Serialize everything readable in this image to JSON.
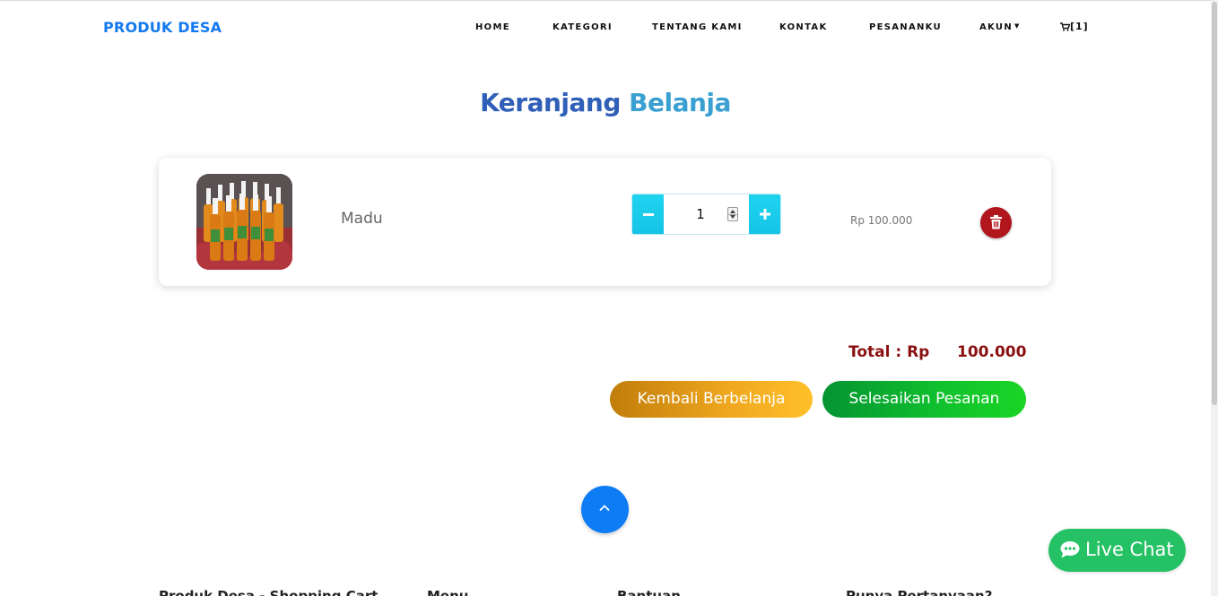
{
  "brand": "PRODUK DESA",
  "nav": {
    "home": "HOME",
    "kategori": "KATEGORI",
    "tentang": "TENTANG KAMI",
    "kontak": "KONTAK",
    "pesananku": "PESANANKU",
    "akun": "AKUN",
    "cart_count": "[1]"
  },
  "page": {
    "title_part1": "Keranjang",
    "title_part2": "Belanja"
  },
  "cart_items": [
    {
      "name": "Madu",
      "quantity": "1",
      "price": "Rp 100.000"
    }
  ],
  "summary": {
    "total_label": "Total : Rp",
    "total_value": "100.000",
    "back_button": "Kembali Berbelanja",
    "finish_button": "Selesaikan Pesanan"
  },
  "live_chat": "Live Chat",
  "footer_columns": [
    "Produk Desa - Shopping Cart",
    "Menu",
    "Bantuan",
    "Punya Pertanyaan?"
  ],
  "colors": {
    "brand": "#1479ee",
    "title_dark": "#2f5fb7",
    "title_light": "#3a9fd1",
    "qty_accent": "#15c4e6",
    "delete": "#b0161c",
    "total": "#8a1010",
    "back_button": "#f0a81f",
    "finish_button": "#10c22d",
    "to_top": "#0d7cf5",
    "live_chat": "#25c265"
  },
  "icons": {
    "cart": "shopping-cart-icon",
    "delete": "trash-icon",
    "to_top": "chevron-up-icon",
    "live_chat": "chat-bubble-icon"
  }
}
